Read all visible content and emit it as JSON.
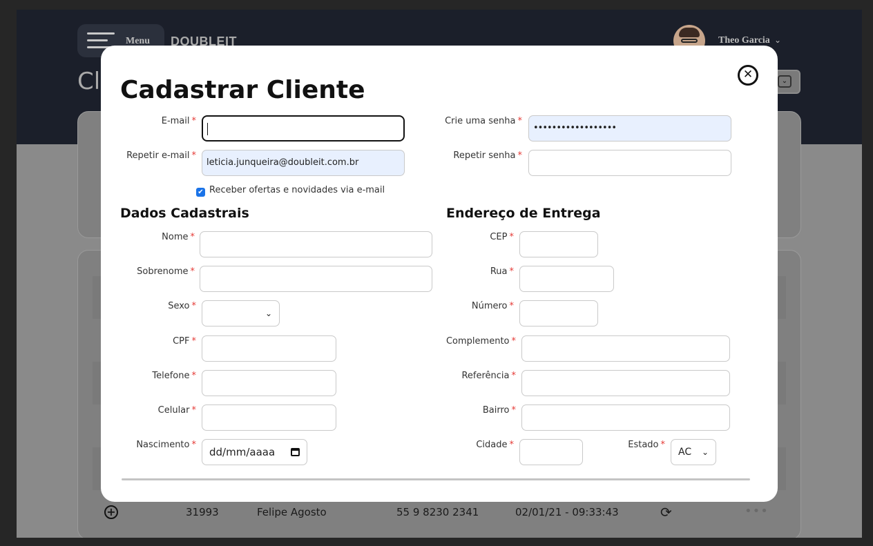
{
  "app": {
    "menu_label": "Menu",
    "brand": "DOUBLEIT",
    "user_name": "Theo Garcia",
    "user_chevron": "⌄",
    "page_title_partial": "Cl",
    "table_row": {
      "plus_icon": "+",
      "id": "31993",
      "name": "Felipe Agosto",
      "phone": "55 9 8230 2341",
      "datetime": "02/01/21 - 09:33:43",
      "sync_icon": "⟳",
      "more_icon": "•••"
    }
  },
  "modal": {
    "title": "Cadastrar Cliente",
    "close_icon": "✕",
    "account": {
      "email_label": "E-mail",
      "email_value": "",
      "repeat_email_label": "Repetir e-mail",
      "repeat_email_value": "leticia.junqueira@doubleit.com.br",
      "password_label": "Crie uma senha",
      "password_value": "••••••••••••••••••",
      "repeat_password_label": "Repetir senha",
      "repeat_password_value": "",
      "newsletter_label": "Receber ofertas e novidades via e-mail",
      "newsletter_checked": true
    },
    "personal": {
      "section_title": "Dados Cadastrais",
      "nome_label": "Nome",
      "sobrenome_label": "Sobrenome",
      "sexo_label": "Sexo",
      "sexo_value": "",
      "cpf_label": "CPF",
      "telefone_label": "Telefone",
      "celular_label": "Celular",
      "nascimento_label": "Nascimento",
      "nascimento_placeholder": "dd/mm/aaaa"
    },
    "address": {
      "section_title": "Endereço de Entrega",
      "cep_label": "CEP",
      "rua_label": "Rua",
      "numero_label": "Número",
      "complemento_label": "Complemento",
      "referencia_label": "Referência",
      "bairro_label": "Bairro",
      "cidade_label": "Cidade",
      "estado_label": "Estado",
      "estado_value": "AC"
    },
    "required_marker": "*",
    "colors": {
      "required": "#e53935",
      "autofill": "#e8f0fe",
      "checkbox": "#1a73e8"
    }
  }
}
